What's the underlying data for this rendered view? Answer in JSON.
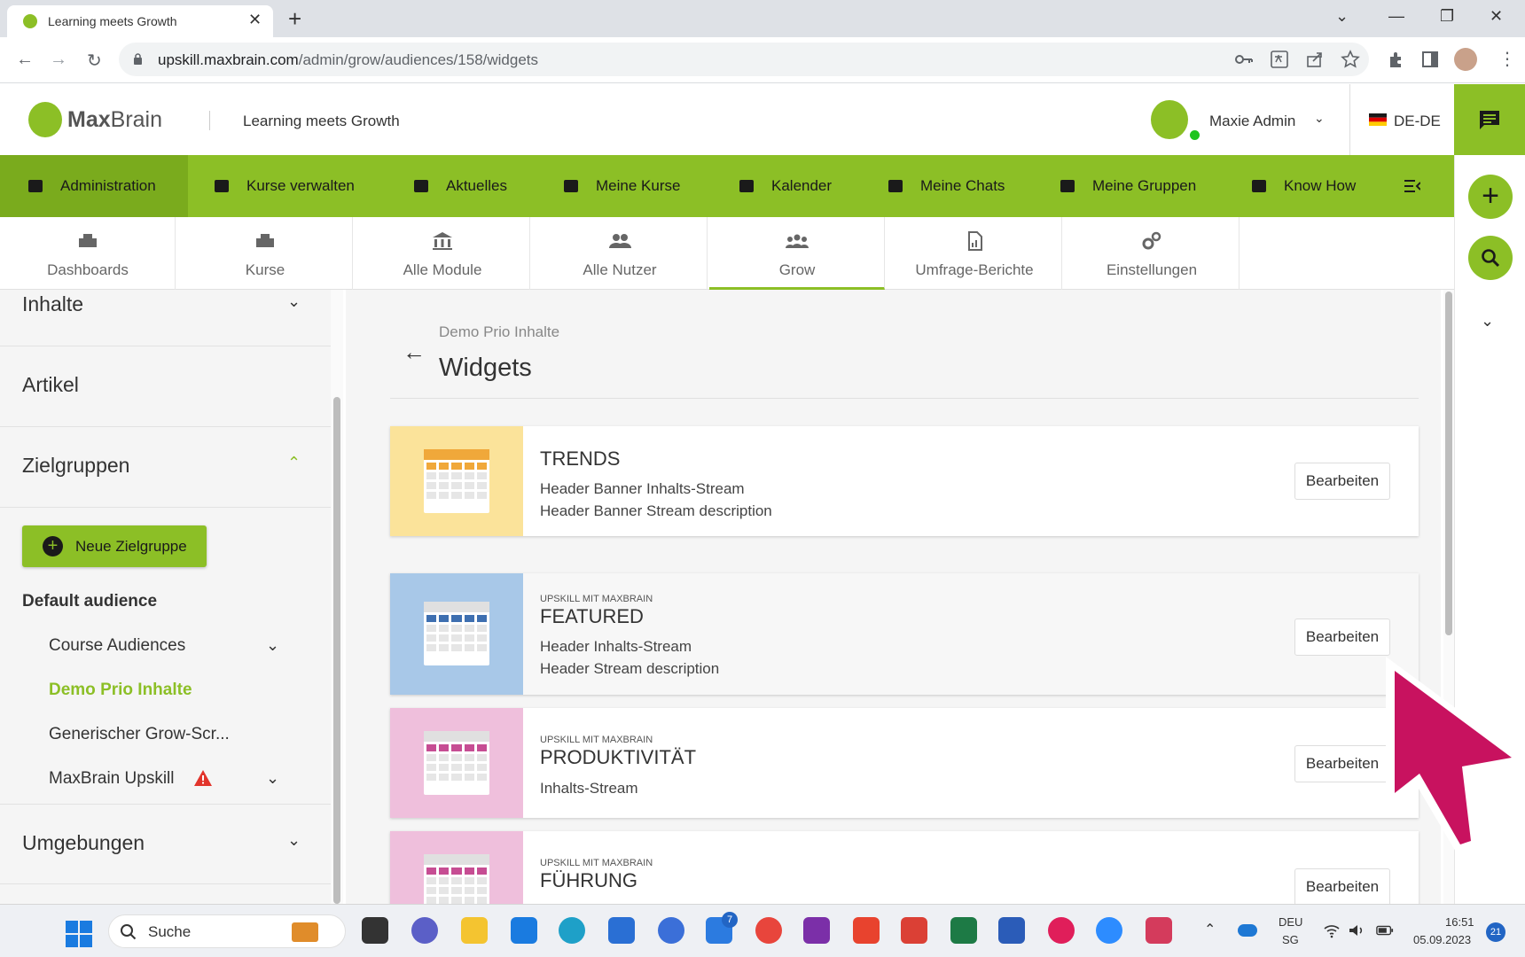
{
  "browser": {
    "tab_title": "Learning meets Growth",
    "tab_close": "✕",
    "new_tab": "+",
    "url_host": "upskill.maxbrain.com",
    "url_path": "/admin/grow/audiences/158/widgets",
    "window_controls": [
      "⌄",
      "—",
      "❐",
      "✕"
    ]
  },
  "header": {
    "brand_bold": "Max",
    "brand_light": "Brain",
    "title": "Learning meets Growth",
    "user_name": "Maxie Admin",
    "language": "DE-DE"
  },
  "main_nav": [
    {
      "label": "Administration",
      "icon": "grid-icon"
    },
    {
      "label": "Kurse verwalten",
      "icon": "id-card-icon"
    },
    {
      "label": "Aktuelles",
      "icon": "grid-icon"
    },
    {
      "label": "Meine Kurse",
      "icon": "graduation-cap-icon"
    },
    {
      "label": "Kalender",
      "icon": "calendar-icon"
    },
    {
      "label": "Meine Chats",
      "icon": "tablet-icon"
    },
    {
      "label": "Meine Gruppen",
      "icon": "id-card-icon"
    },
    {
      "label": "Know How",
      "icon": "book-icon"
    }
  ],
  "sub_tabs": [
    {
      "label": "Dashboards",
      "icon": "dashboard-icon"
    },
    {
      "label": "Kurse",
      "icon": "courses-icon"
    },
    {
      "label": "Alle Module",
      "icon": "bank-icon"
    },
    {
      "label": "Alle Nutzer",
      "icon": "users-icon"
    },
    {
      "label": "Grow",
      "icon": "group-icon"
    },
    {
      "label": "Umfrage-Berichte",
      "icon": "report-icon"
    },
    {
      "label": "Einstellungen",
      "icon": "gears-icon"
    }
  ],
  "sidebar": {
    "sections": {
      "inhalte": "Inhalte",
      "artikel": "Artikel",
      "zielgruppen": "Zielgruppen",
      "umgebungen": "Umgebungen"
    },
    "new_group_button": "Neue Zielgruppe",
    "default_audience": "Default audience",
    "items": [
      {
        "label": "Course Audiences"
      },
      {
        "label": "Demo Prio Inhalte"
      },
      {
        "label": "Generischer Grow-Scr..."
      },
      {
        "label": "MaxBrain Upskill"
      }
    ]
  },
  "content": {
    "breadcrumb": "Demo Prio Inhalte",
    "title": "Widgets",
    "edit_label": "Bearbeiten",
    "widgets": [
      {
        "eyebrow": "",
        "title": "TRENDS",
        "lines": [
          "Header Banner Inhalts-Stream",
          "Header Banner Stream description"
        ],
        "thumb_bg": "#fbe39a",
        "accent": "#f0a83a"
      },
      {
        "eyebrow": "UPSKILL MIT MAXBRAIN",
        "title": "FEATURED",
        "lines": [
          "Header Inhalts-Stream",
          "Header Stream description"
        ],
        "thumb_bg": "#a8c8e8",
        "accent": "#3e6fb0"
      },
      {
        "eyebrow": "UPSKILL MIT MAXBRAIN",
        "title": "PRODUKTIVITÄT",
        "lines": [
          "Inhalts-Stream"
        ],
        "thumb_bg": "#efbfdc",
        "accent": "#c64d93"
      },
      {
        "eyebrow": "UPSKILL MIT MAXBRAIN",
        "title": "FÜHRUNG",
        "lines": [],
        "thumb_bg": "#efbfdc",
        "accent": "#c64d93"
      }
    ]
  },
  "taskbar": {
    "search_label": "Suche",
    "lang_top": "DEU",
    "lang_bottom": "SG",
    "time": "16:51",
    "date": "05.09.2023",
    "notifications": "21",
    "app_badge": "7"
  },
  "colors": {
    "brand_green": "#8cbf26",
    "cursor_magenta": "#c8125f"
  }
}
